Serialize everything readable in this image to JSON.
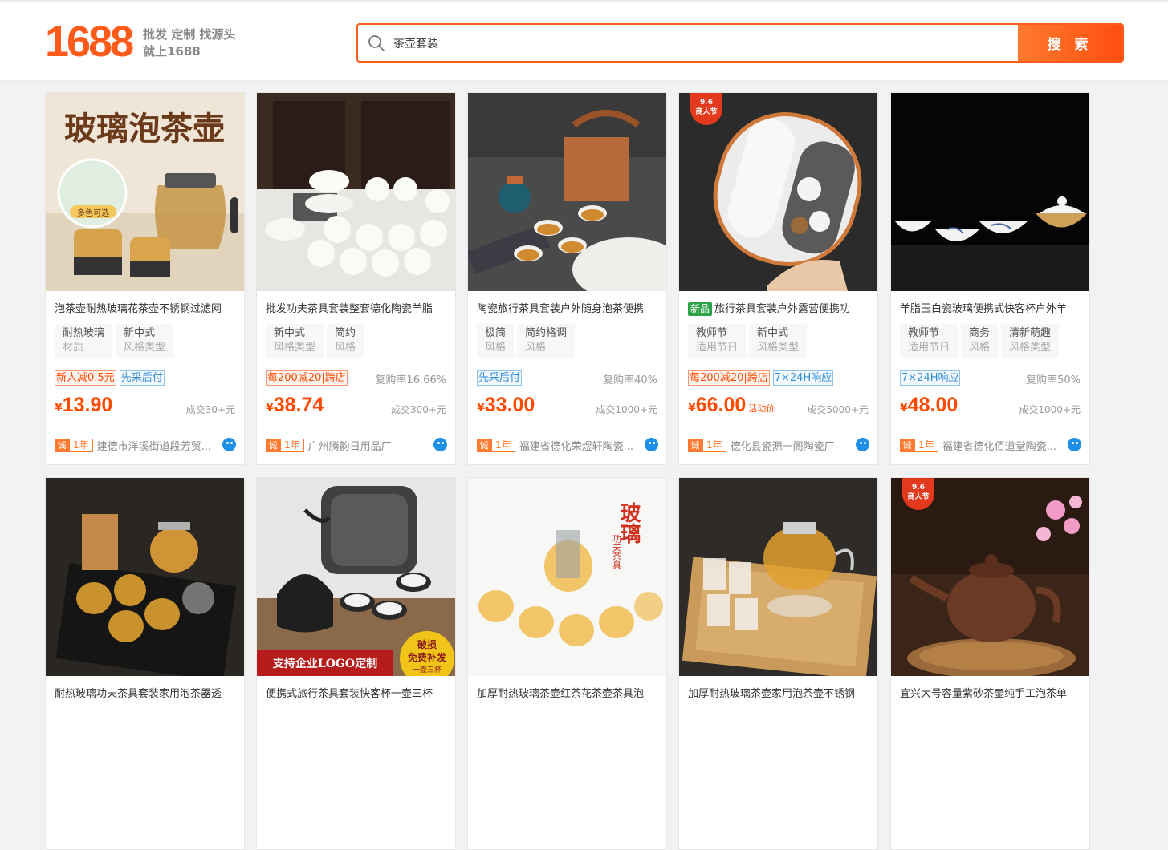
{
  "header": {
    "logo_number": "1688",
    "slogan_line1": "批发 定制 找源头",
    "slogan_line2": "就上1688",
    "search_value": "茶壶套装",
    "search_button": "搜 索"
  },
  "colors": {
    "brand": "#ff5b1a",
    "price": "#ff4a00",
    "tag_blue": "#2f8dd9",
    "new_green": "#2ba245"
  },
  "products": [
    {
      "title": "泡茶壶耐热玻璃花茶壶不锈钢过滤网",
      "attrs": [
        {
          "k": "耐热玻璃",
          "v": "材质"
        },
        {
          "k": "新中式",
          "v": "风格类型"
        }
      ],
      "promos": [
        {
          "text": "新人减0.5元",
          "style": "orange"
        },
        {
          "text": "先采后付",
          "style": "blue"
        }
      ],
      "repurchase": "",
      "currency": "¥",
      "price": "13.90",
      "activity": "",
      "sold": "成交30+元",
      "cheng": "诚",
      "years": "1年",
      "shop": "建德市洋溪街道段芳贸..."
    },
    {
      "title": "批发功夫茶具套装整套德化陶瓷羊脂",
      "attrs": [
        {
          "k": "新中式",
          "v": "风格类型"
        },
        {
          "k": "简约",
          "v": "风格"
        }
      ],
      "promos": [
        {
          "text": "每200减20|跨店",
          "style": "orange"
        }
      ],
      "repurchase": "复购率16.66%",
      "currency": "¥",
      "price": "38.74",
      "activity": "",
      "sold": "成交300+元",
      "cheng": "诚",
      "years": "1年",
      "shop": "广州腾韵日用品厂"
    },
    {
      "title": "陶瓷旅行茶具套装户外随身泡茶便携",
      "attrs": [
        {
          "k": "极简",
          "v": "风格"
        },
        {
          "k": "简约格调",
          "v": "风格"
        }
      ],
      "promos": [
        {
          "text": "先采后付",
          "style": "blue"
        }
      ],
      "repurchase": "复购率40%",
      "currency": "¥",
      "price": "33.00",
      "activity": "",
      "sold": "成交1000+元",
      "cheng": "诚",
      "years": "1年",
      "shop": "福建省德化荣煜轩陶瓷..."
    },
    {
      "title": "旅行茶具套装户外露营便携功",
      "new_tag": "新品",
      "attrs": [
        {
          "k": "教师节",
          "v": "适用节日"
        },
        {
          "k": "新中式",
          "v": "风格类型"
        }
      ],
      "promos": [
        {
          "text": "每200减20|跨店",
          "style": "orange"
        },
        {
          "text": "7×24H响应",
          "style": "blue"
        }
      ],
      "repurchase": "",
      "currency": "¥",
      "price": "66.00",
      "activity": "活动价",
      "sold": "成交5000+元",
      "cheng": "诚",
      "years": "1年",
      "shop": "德化县瓷源一阁陶瓷厂",
      "badge": [
        "9.6",
        "商人节"
      ]
    },
    {
      "title": "羊脂玉白瓷玻璃便携式快客杯户外羊",
      "attrs": [
        {
          "k": "教师节",
          "v": "适用节日"
        },
        {
          "k": "商务",
          "v": "风格"
        },
        {
          "k": "清新萌趣",
          "v": "风格类型"
        }
      ],
      "promos": [
        {
          "text": "7×24H响应",
          "style": "blue"
        }
      ],
      "repurchase": "复购率50%",
      "currency": "¥",
      "price": "48.00",
      "activity": "",
      "sold": "成交1000+元",
      "cheng": "诚",
      "years": "1年",
      "shop": "福建省德化佰道堂陶瓷..."
    },
    {
      "title": "耐热玻璃功夫茶具套装家用泡茶器透"
    },
    {
      "title": "便携式旅行茶具套装快客杯一壶三杯"
    },
    {
      "title": "加厚耐热玻璃茶壶红茶花茶壶茶具泡"
    },
    {
      "title": "加厚耐热玻璃茶壶家用泡茶壶不锈钢"
    },
    {
      "title": "宜兴大号容量紫砂茶壶纯手工泡茶单",
      "badge": [
        "9.6",
        "商人节"
      ]
    }
  ],
  "image_text": {
    "p1_banner": "玻璃泡茶壶",
    "p1_bubble": "多色可选",
    "p7_banner": "支持企业LOGO定制",
    "p7_seal": [
      "破损",
      "免费补发",
      "一壶三杯"
    ],
    "p8_vertical": "玻璃",
    "p8_small": "功夫茶具"
  }
}
